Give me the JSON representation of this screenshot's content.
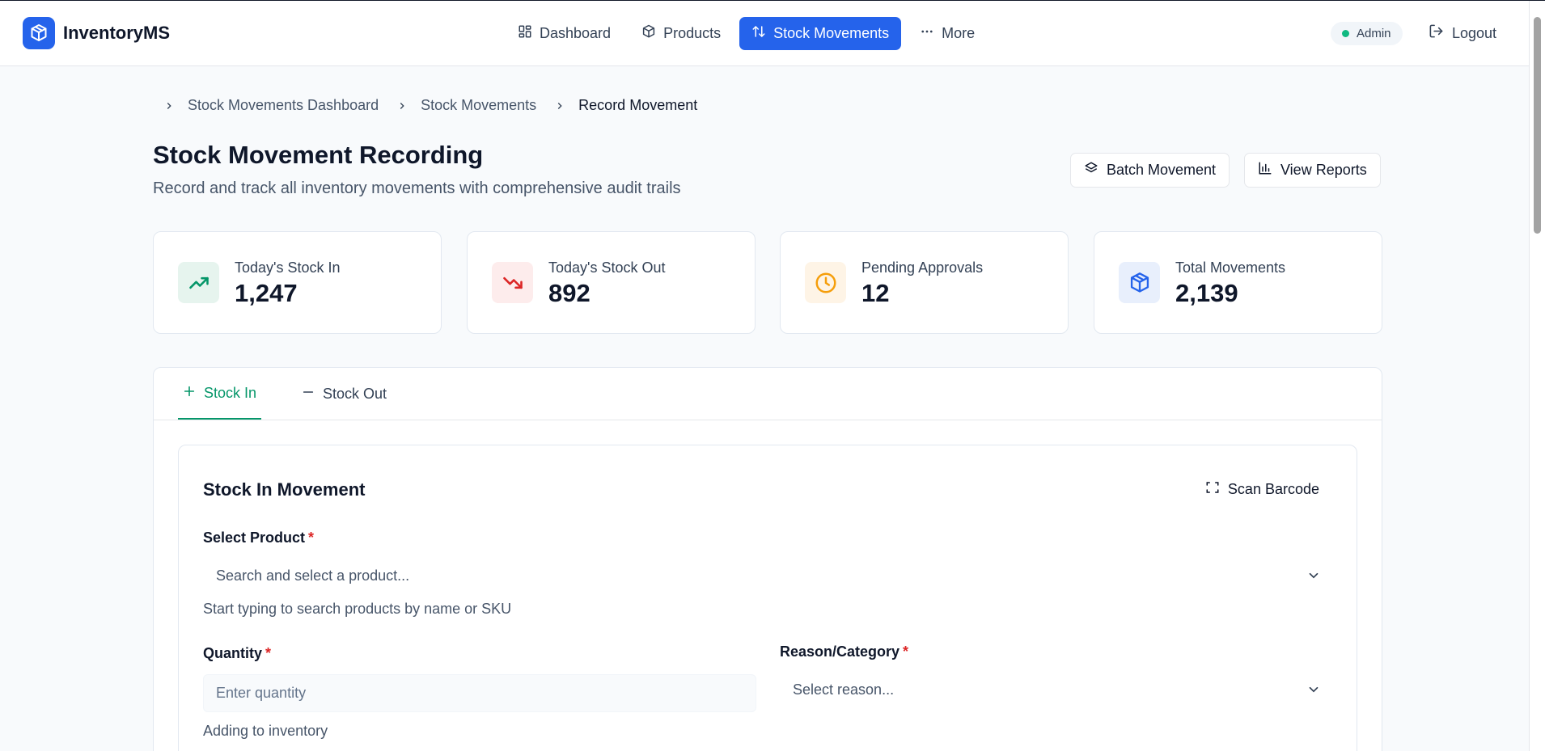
{
  "app": {
    "name": "InventoryMS"
  },
  "nav": {
    "items": [
      {
        "label": "Dashboard",
        "icon": "grid-icon",
        "active": false
      },
      {
        "label": "Products",
        "icon": "package-icon",
        "active": false
      },
      {
        "label": "Stock Movements",
        "icon": "arrows-up-down-icon",
        "active": true
      },
      {
        "label": "More",
        "icon": "more-dots-icon",
        "active": false
      }
    ]
  },
  "user": {
    "role": "Admin",
    "logout_label": "Logout"
  },
  "breadcrumb": [
    "Stock Movements Dashboard",
    "Stock Movements",
    "Record Movement"
  ],
  "page": {
    "title": "Stock Movement Recording",
    "subtitle": "Record and track all inventory movements with comprehensive audit trails",
    "batch_label": "Batch Movement",
    "reports_label": "View Reports"
  },
  "stats": [
    {
      "label": "Today's Stock In",
      "value": "1,247",
      "icon": "trending-up-icon",
      "color": "#059669",
      "bg": "#e6f4ee"
    },
    {
      "label": "Today's Stock Out",
      "value": "892",
      "icon": "trending-down-icon",
      "color": "#dc2626",
      "bg": "#fdecec"
    },
    {
      "label": "Pending Approvals",
      "value": "12",
      "icon": "clock-icon",
      "color": "#f59e0b",
      "bg": "#fef4e6"
    },
    {
      "label": "Total Movements",
      "value": "2,139",
      "icon": "package-icon",
      "color": "#2563eb",
      "bg": "#e8effc"
    }
  ],
  "tabs": [
    {
      "label": "Stock In",
      "icon": "plus-icon",
      "active": true
    },
    {
      "label": "Stock Out",
      "icon": "minus-icon",
      "active": false
    }
  ],
  "form": {
    "title": "Stock In Movement",
    "scan_label": "Scan Barcode",
    "product_label": "Select Product",
    "product_placeholder": "Search and select a product...",
    "product_helper": "Start typing to search products by name or SKU",
    "quantity_label": "Quantity",
    "quantity_placeholder": "Enter quantity",
    "quantity_helper": "Adding to inventory",
    "reason_label": "Reason/Category",
    "reason_placeholder": "Select reason...",
    "required_mark": "*"
  },
  "colors": {
    "accent": "#2563eb",
    "success": "#059669",
    "danger": "#dc2626"
  }
}
